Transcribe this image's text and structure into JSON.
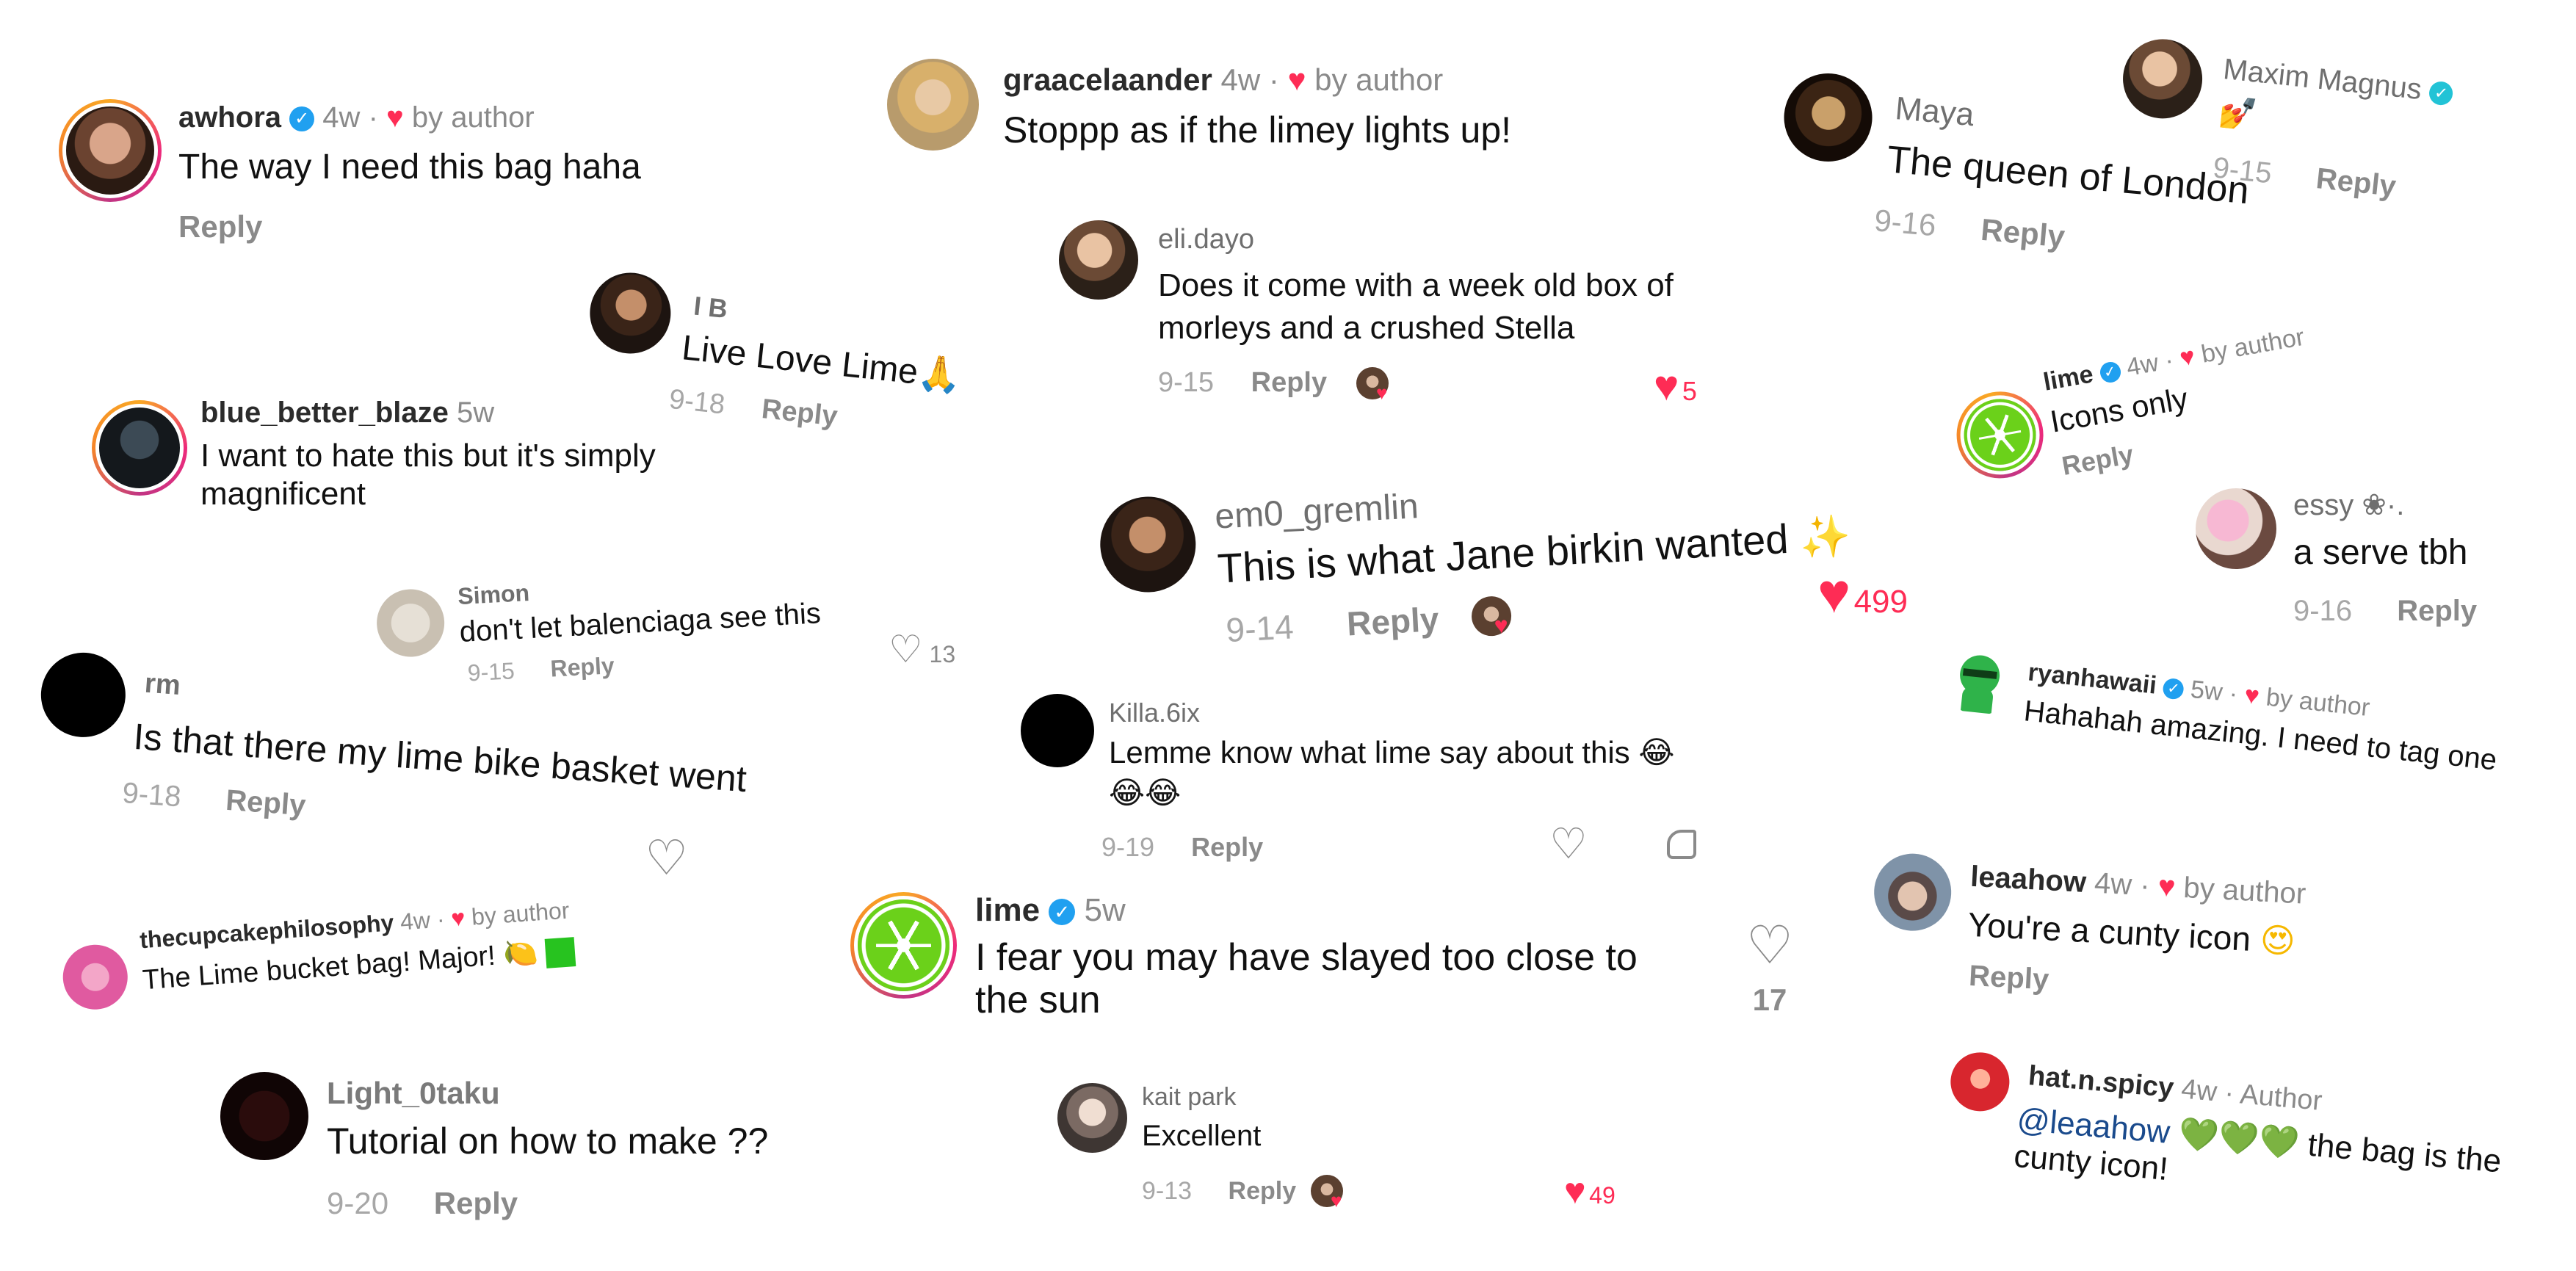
{
  "common": {
    "reply": "Reply",
    "by_author": "by author",
    "heart": "♥",
    "outline_heart": "♡",
    "verified_mark": "✓"
  },
  "comments": {
    "awhora": {
      "user": "awhora",
      "age": "4w",
      "sep": "·",
      "text": "The way I need this bag haha"
    },
    "ib": {
      "user": "I B",
      "text": "Live Love Lime",
      "emoji": "🙏",
      "date": "9-18"
    },
    "blue": {
      "user": "blue_better_blaze",
      "age": "5w",
      "text": "I want to hate this but it's simply magnificent"
    },
    "simon": {
      "user": "Simon",
      "text": "don't let balenciaga see this",
      "date": "9-15",
      "likes": "13"
    },
    "rm": {
      "user": "rm",
      "text": "Is that there my lime bike basket went",
      "date": "9-18"
    },
    "cupcake": {
      "user": "thecupcakephilosophy",
      "age": "4w",
      "sep": "·",
      "text": "The Lime bucket bag! Major!",
      "emoji": "🍋"
    },
    "light": {
      "user": "Light_0taku",
      "text": "Tutorial on how to make ??",
      "date": "9-20"
    },
    "graace": {
      "user": "graacelaander",
      "age": "4w",
      "sep": "·",
      "text": "Stoppp as if the limey lights up!"
    },
    "eli": {
      "user": "eli.dayo",
      "text": "Does it come with a week old box of morleys and a crushed Stella",
      "date": "9-15",
      "likes": "5"
    },
    "em0": {
      "user": "em0_gremlin",
      "text": "This is what Jane birkin wanted",
      "emoji": "✨",
      "date": "9-14",
      "likes": "499"
    },
    "killa": {
      "user": "Killa.6ix",
      "text": "Lemme know what lime say about this",
      "emoji": "😂",
      "emoji2": "😂😂",
      "date": "9-19"
    },
    "lime_main": {
      "user": "lime",
      "age": "5w",
      "text": "I fear you may have slayed too close to the sun",
      "likes": "17"
    },
    "kait": {
      "user": "kait park",
      "text": "Excellent",
      "date": "9-13",
      "likes": "49"
    },
    "maya": {
      "user": "Maya",
      "text": "The queen of London",
      "date": "9-16"
    },
    "maxim": {
      "user": "Maxim Magnus",
      "emoji": "💅",
      "date": "9-15"
    },
    "lime_icons": {
      "user": "lime",
      "age": "4w",
      "sep": "·",
      "text": "Icons only"
    },
    "essy": {
      "user": "essy ❀·.",
      "text": "a serve tbh",
      "date": "9-16"
    },
    "ryan": {
      "user": "ryanhawaii",
      "age": "5w",
      "sep": "·",
      "text": "Hahahah amazing. I need to tag one"
    },
    "leaa": {
      "user": "leaahow",
      "age": "4w",
      "sep": "·",
      "text": "You're a cunty icon",
      "emoji": "😍"
    },
    "hat": {
      "user": "hat.n.spicy",
      "age": "4w",
      "sep": "·",
      "badge": "Author",
      "mention": "@leaahow",
      "emoji": "💚💚💚",
      "text_a": "the bag is the",
      "text_b": "cunty icon!"
    }
  },
  "colors": {
    "heart": "#fe2c55",
    "verified": "#20a0f0",
    "lime_green": "#6bd11a"
  }
}
